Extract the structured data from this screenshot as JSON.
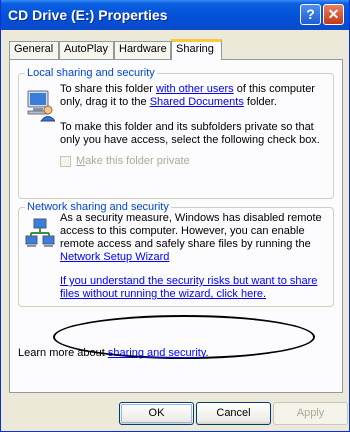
{
  "window": {
    "title": "CD Drive (E:) Properties",
    "help_glyph": "?",
    "close_glyph": "✕"
  },
  "tabs": [
    {
      "label": "General"
    },
    {
      "label": "AutoPlay"
    },
    {
      "label": "Hardware"
    },
    {
      "label": "Sharing",
      "active": true
    }
  ],
  "local": {
    "legend": "Local sharing and security",
    "line1a": "To share this folder ",
    "line1b": "with other users",
    "line1c": " of this computer",
    "line2a": "only, drag it to the ",
    "line2b": "Shared Documents",
    "line2c": " folder.",
    "line3": "To make this folder and its subfolders private so that",
    "line4": "only you have access, select the following check box.",
    "checkbox_label_m": "M",
    "checkbox_label_rest": "ake this folder private"
  },
  "network": {
    "legend": "Network sharing and security",
    "line1": "As a security measure, Windows has disabled remote",
    "line2": "access to this computer. However, you can enable",
    "line3": "remote access and safely share files by running the",
    "wizard_link": "Network Setup Wizard",
    "risk_link_line1": "If you understand the security risks but want to share",
    "risk_link_line2": "files without running the wizard, click here."
  },
  "learn_more": {
    "prefix": "Learn more about ",
    "link": "sharing and security",
    "suffix": "."
  },
  "buttons": {
    "ok": "OK",
    "cancel": "Cancel",
    "apply": "Apply"
  },
  "colors": {
    "titlebar": "#0451D8",
    "dialog_bg": "#ECE9D8",
    "link": "#0000FF",
    "group_label": "#0046D5",
    "active_tab_accent": "#FFC83C"
  }
}
